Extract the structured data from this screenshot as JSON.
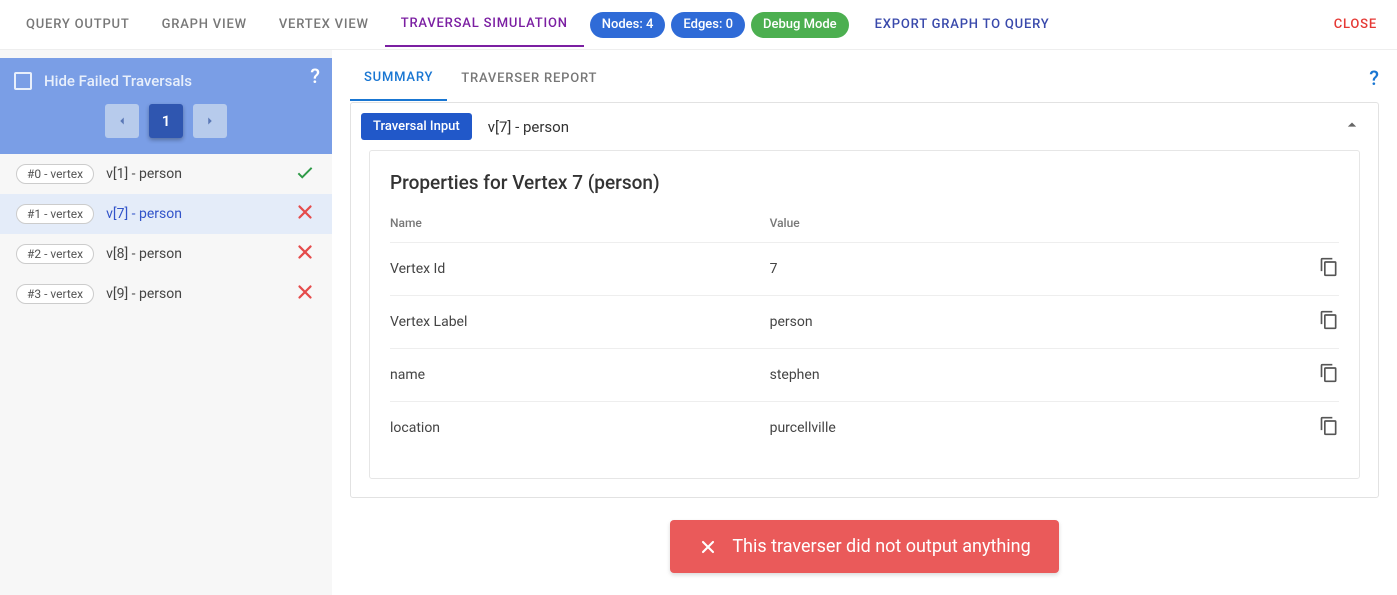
{
  "topbar": {
    "tabs": {
      "query_output": "Query Output",
      "graph_view": "Graph View",
      "vertex_view": "Vertex View",
      "traversal_simulation": "Traversal Simulation"
    },
    "pills": {
      "nodes": "Nodes: 4",
      "edges": "Edges: 0",
      "debug": "Debug Mode"
    },
    "export_label": "Export Graph to Query",
    "close_label": "Close"
  },
  "sidebar": {
    "help": "?",
    "hide_failed_label": "Hide Failed Traversals",
    "current_page": "1",
    "items": [
      {
        "tag": "#0 - vertex",
        "label": "v[1] - person",
        "status": "ok"
      },
      {
        "tag": "#1 - vertex",
        "label": "v[7] - person",
        "status": "fail"
      },
      {
        "tag": "#2 - vertex",
        "label": "v[8] - person",
        "status": "fail"
      },
      {
        "tag": "#3 - vertex",
        "label": "v[9] - person",
        "status": "fail"
      }
    ],
    "selected_index": 1
  },
  "content": {
    "tabs": {
      "summary": "Summary",
      "traverser_report": "Traverser Report"
    },
    "help": "?",
    "traversal_input_badge": "Traversal Input",
    "traversal_input_label": "v[7] - person",
    "properties_title": "Properties for Vertex 7 (person)",
    "columns": {
      "name": "Name",
      "value": "Value"
    },
    "rows": [
      {
        "name": "Vertex Id",
        "value": "7"
      },
      {
        "name": "Vertex Label",
        "value": "person"
      },
      {
        "name": "name",
        "value": "stephen"
      },
      {
        "name": "location",
        "value": "purcellville"
      }
    ],
    "alert": "This traverser did not output anything"
  }
}
